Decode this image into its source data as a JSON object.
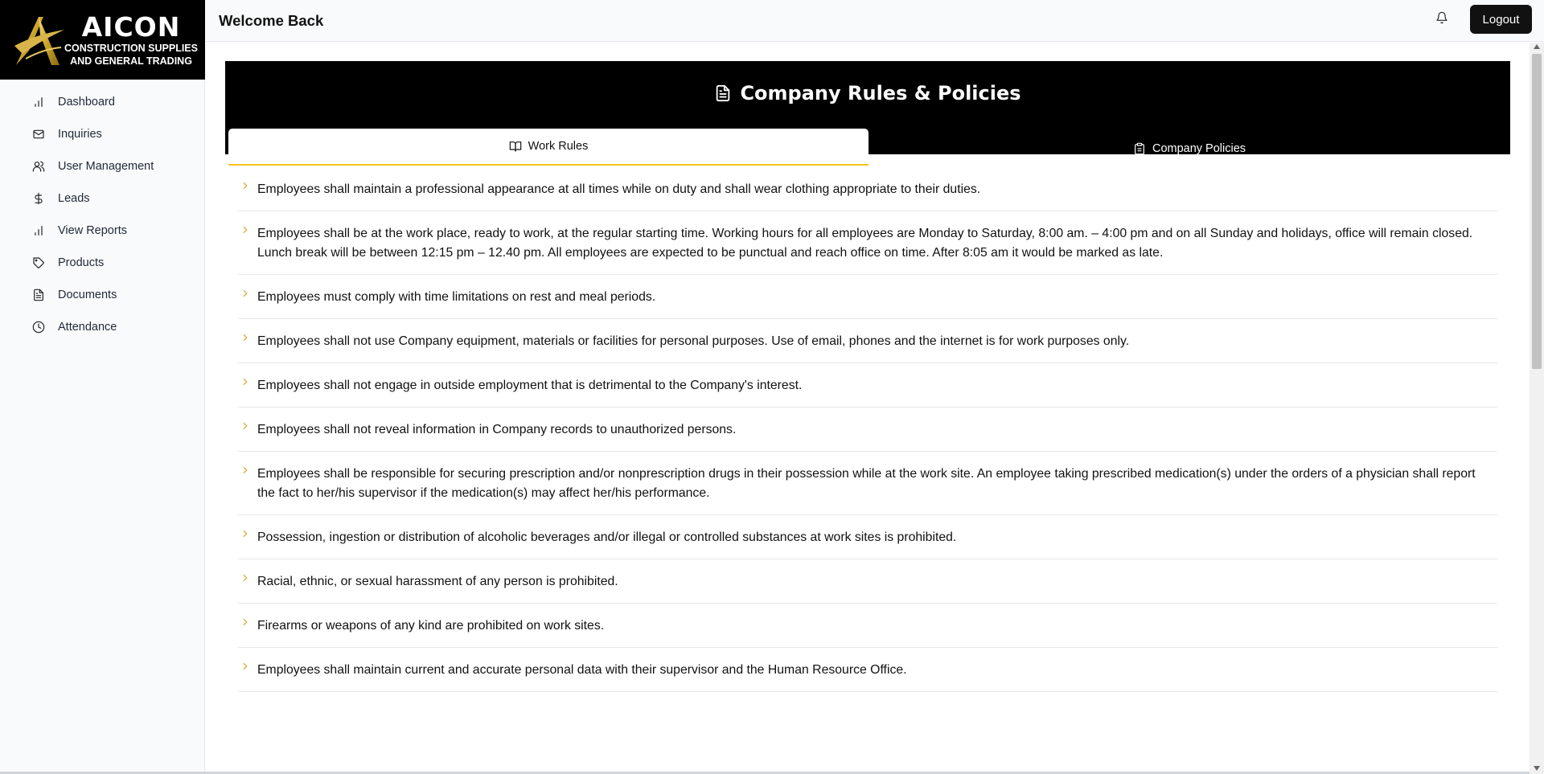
{
  "brand": {
    "name": "AICON",
    "subtitle_line1": "CONSTRUCTION SUPPLIES",
    "subtitle_line2": "AND GENERAL TRADING",
    "colors": {
      "gold": "#c9a227",
      "black": "#000000"
    }
  },
  "sidebar": {
    "items": [
      {
        "label": "Dashboard",
        "icon": "bar-chart-icon"
      },
      {
        "label": "Inquiries",
        "icon": "mail-icon"
      },
      {
        "label": "User Management",
        "icon": "users-icon"
      },
      {
        "label": "Leads",
        "icon": "dollar-icon"
      },
      {
        "label": "View Reports",
        "icon": "bar-chart-icon"
      },
      {
        "label": "Products",
        "icon": "tag-icon"
      },
      {
        "label": "Documents",
        "icon": "file-icon"
      },
      {
        "label": "Attendance",
        "icon": "clock-icon"
      }
    ]
  },
  "header": {
    "title": "Welcome Back",
    "notification_icon": "bell-icon",
    "logout_label": "Logout"
  },
  "page": {
    "title": "Company Rules & Policies",
    "tabs": [
      {
        "label": "Work Rules",
        "icon": "book-open-icon",
        "active": true
      },
      {
        "label": "Company Policies",
        "icon": "clipboard-icon",
        "active": false
      }
    ],
    "accent_color": "#f5c518",
    "chevron_color": "#e0a01a"
  },
  "rules": [
    "Employees shall maintain a professional appearance at all times while on duty and shall wear clothing appropriate to their duties.",
    "Employees shall be at the work place, ready to work, at the regular starting time. Working hours for all employees are Monday to Saturday, 8:00 am. – 4:00 pm and on all Sunday and holidays, office will remain closed. Lunch break will be between 12:15 pm – 12.40 pm. All employees are expected to be punctual and reach office on time. After 8:05 am it would be marked as late.",
    "Employees must comply with time limitations on rest and meal periods.",
    "Employees shall not use Company equipment, materials or facilities for personal purposes. Use of email, phones and the internet is for work purposes only.",
    "Employees shall not engage in outside employment that is detrimental to the Company's interest.",
    "Employees shall not reveal information in Company records to unauthorized persons.",
    "Employees shall be responsible for securing prescription and/or nonprescription drugs in their possession while at the work site. An employee taking prescribed medication(s) under the orders of a physician shall report the fact to her/his supervisor if the medication(s) may affect her/his performance.",
    "Possession, ingestion or distribution of alcoholic beverages and/or illegal or controlled substances at work sites is prohibited.",
    "Racial, ethnic, or sexual harassment of any person is prohibited.",
    "Firearms or weapons of any kind are prohibited on work sites.",
    "Employees shall maintain current and accurate personal data with their supervisor and the Human Resource Office."
  ]
}
